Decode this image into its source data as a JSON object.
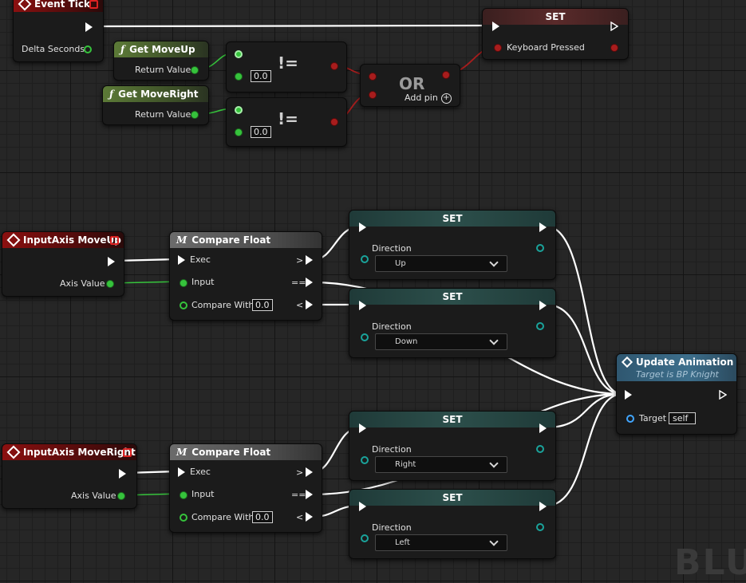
{
  "nodes": {
    "event_tick": {
      "title": "Event Tick",
      "delta_label": "Delta Seconds"
    },
    "get_moveup": {
      "title": "Get MoveUp",
      "return_label": "Return Value"
    },
    "get_moveright": {
      "title": "Get MoveRight",
      "return_label": "Return Value"
    },
    "neq1": {
      "op": "!=",
      "value": "0.0"
    },
    "neq2": {
      "op": "!=",
      "value": "0.0"
    },
    "or_node": {
      "op": "OR",
      "add_pin": "Add pin"
    },
    "set_keyboard": {
      "title": "SET",
      "var_label": "Keyboard Pressed"
    },
    "inputaxis_up": {
      "title": "InputAxis MoveUp",
      "axis_label": "Axis Value"
    },
    "inputaxis_right": {
      "title": "InputAxis MoveRight",
      "axis_label": "Axis Value"
    },
    "compare_up": {
      "title": "Compare Float",
      "exec": "Exec",
      "input": "Input",
      "compare_with": "Compare With",
      "value": "0.0",
      "gt": ">",
      "eq": "==",
      "lt": "<"
    },
    "compare_right": {
      "title": "Compare Float",
      "exec": "Exec",
      "input": "Input",
      "compare_with": "Compare With",
      "value": "0.0",
      "gt": ">",
      "eq": "==",
      "lt": "<"
    },
    "set_up": {
      "title": "SET",
      "var_label": "Direction",
      "value": "Up"
    },
    "set_down": {
      "title": "SET",
      "var_label": "Direction",
      "value": "Down"
    },
    "set_right": {
      "title": "SET",
      "var_label": "Direction",
      "value": "Right"
    },
    "set_left": {
      "title": "SET",
      "var_label": "Direction",
      "value": "Left"
    },
    "update_anim": {
      "title": "Update Animation",
      "subtitle": "Target is BP Knight",
      "target_label": "Target",
      "target_value": "self"
    }
  },
  "colors": {
    "exec": "#ffffff",
    "float": "#36c33c",
    "bool": "#a81d1d",
    "enum": "#1aa39b",
    "object": "#41a6ff"
  },
  "watermark": "BLU"
}
